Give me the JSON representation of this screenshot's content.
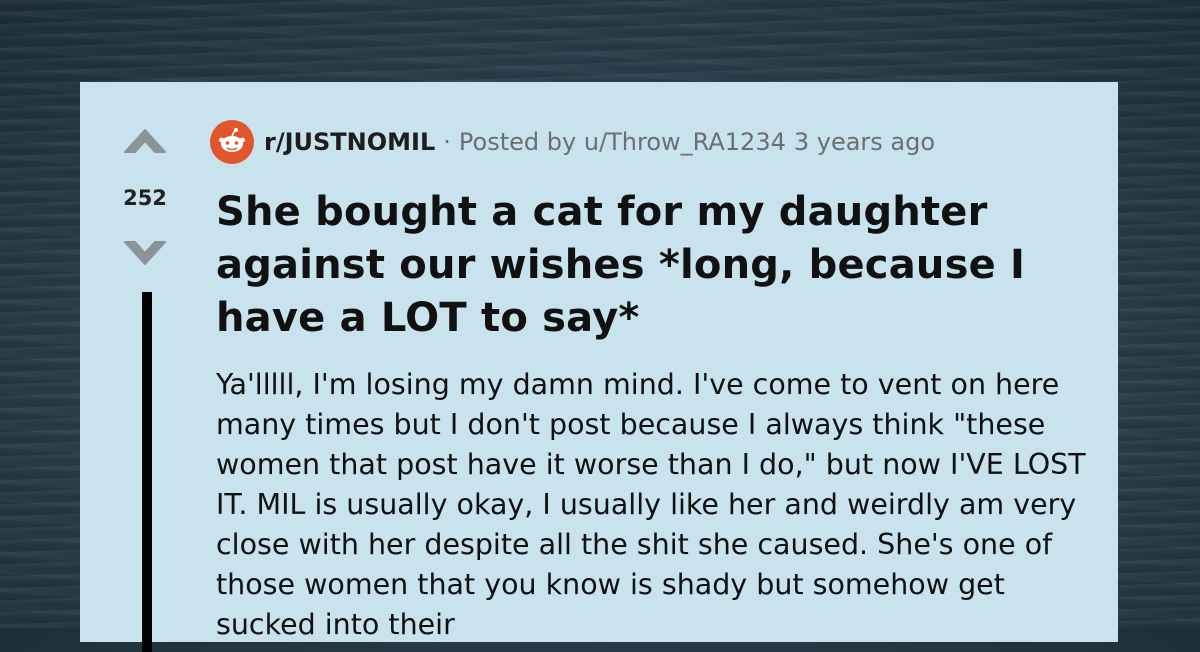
{
  "post": {
    "subreddit": "r/JUSTNOMIL",
    "separator": "·",
    "posted_by": "Posted by u/Throw_RA1234",
    "time_ago": "3 years ago",
    "score": "252",
    "title": "She bought a cat for my daughter against our wishes *long, because I have a LOT to say*",
    "body": "Ya'lllll, I'm losing my damn mind. I've come to vent on here many times but I don't post because I always think \"these women that post have it worse than I do,\" but now I'VE LOST IT. MIL is usually okay, I usually like her and weirdly am very close with her despite all the shit she caused. She's one of those women that you know is shady but somehow get sucked into their"
  },
  "icons": {
    "upvote": "upvote-arrow-icon",
    "downvote": "downvote-arrow-icon",
    "subreddit": "subreddit-snoo-icon"
  },
  "colors": {
    "card_background": "#c8e2ee",
    "subreddit_icon": "#e0572d",
    "meta_text": "#6a6f73",
    "arrow": "#8b9399"
  }
}
